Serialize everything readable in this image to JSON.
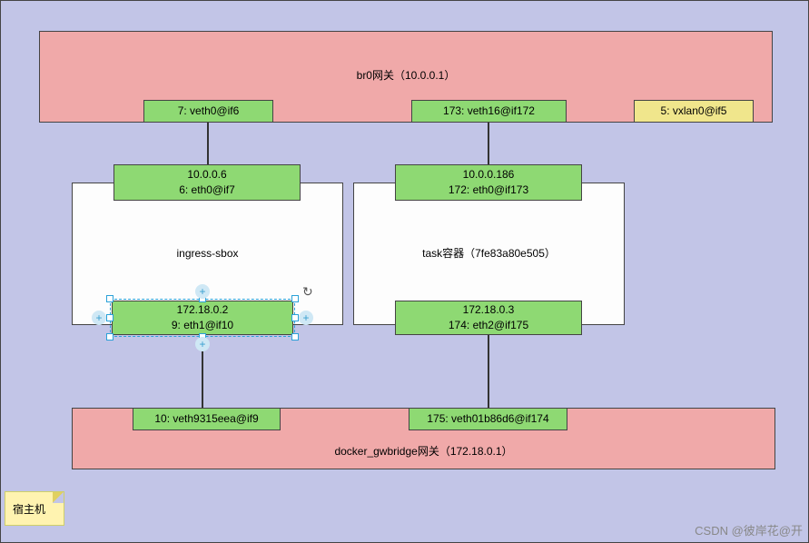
{
  "header": {
    "title": "br0网关（10.0.0.1）",
    "veth0": "7: veth0@if6",
    "veth16": "173: veth16@if172",
    "vxlan": "5: vxlan0@if5"
  },
  "container_left": {
    "top_ip": "10.0.0.6",
    "top_if": "6: eth0@if7",
    "name": "ingress-sbox",
    "bottom_ip": "172.18.0.2",
    "bottom_if": "9: eth1@if10"
  },
  "container_right": {
    "top_ip": "10.0.0.186",
    "top_if": "172: eth0@if173",
    "name": "task容器（7fe83a80e505）",
    "bottom_ip": "172.18.0.3",
    "bottom_if": "174: eth2@if175"
  },
  "footer": {
    "veth_left": "10: veth9315eea@if9",
    "veth_right": "175: veth01b86d6@if174",
    "title": "docker_gwbridge网关（172.18.0.1）"
  },
  "note": "宿主机",
  "watermark": "CSDN @彼岸花@开"
}
